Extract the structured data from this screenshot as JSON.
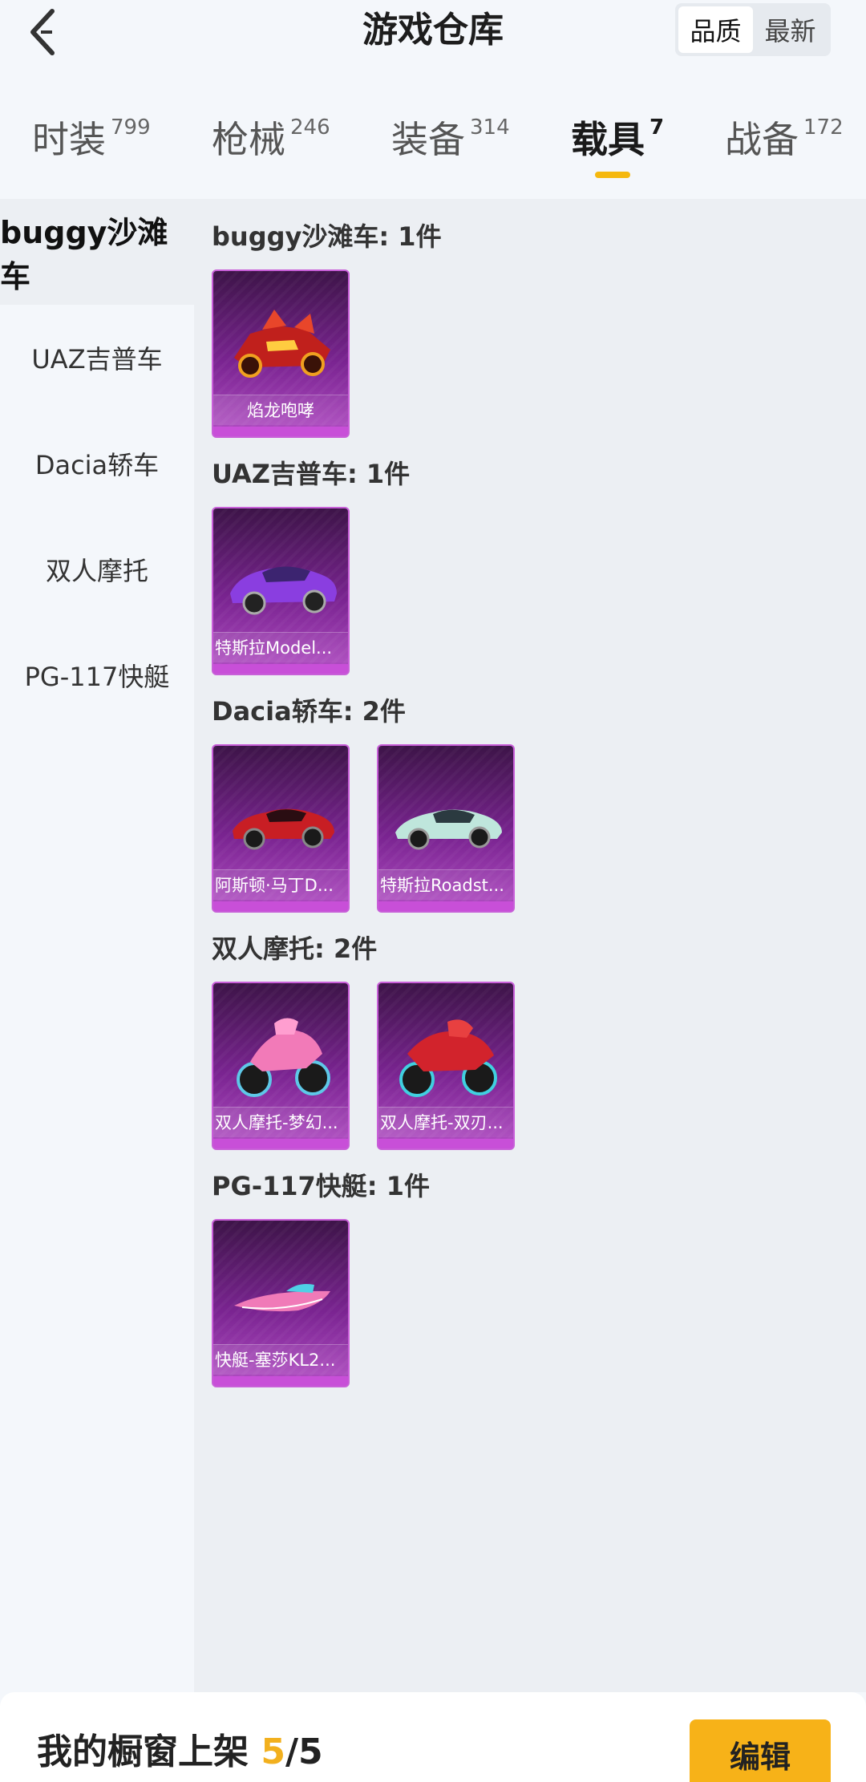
{
  "header": {
    "title": "游戏仓库",
    "sort_options": [
      "品质",
      "最新"
    ],
    "active_sort": "品质"
  },
  "tabs": [
    {
      "label": "时装",
      "count": "799"
    },
    {
      "label": "枪械",
      "count": "246"
    },
    {
      "label": "装备",
      "count": "314"
    },
    {
      "label": "载具",
      "count": "7"
    },
    {
      "label": "战备",
      "count": "172"
    }
  ],
  "sidebar": {
    "items": [
      "buggy沙滩车",
      "UAZ吉普车",
      "Dacia轿车",
      "双人摩托",
      "PG-117快艇"
    ]
  },
  "groups": [
    {
      "title": "buggy沙滩车: 1件",
      "items": [
        "焰龙咆哮"
      ]
    },
    {
      "title": "UAZ吉普车: 1件",
      "items": [
        "特斯拉Model..."
      ]
    },
    {
      "title": "Dacia轿车: 2件",
      "items": [
        "阿斯顿·马丁D...",
        "特斯拉Roadst..."
      ]
    },
    {
      "title": "双人摩托: 2件",
      "items": [
        "双人摩托-梦幻...",
        "双人摩托-双刃..."
      ]
    },
    {
      "title": "PG-117快艇: 1件",
      "items": [
        "快艇-塞莎KL2..."
      ]
    }
  ],
  "bottom": {
    "shelf_label": "我的橱窗上架",
    "shelf_current": "5",
    "shelf_total": "/5",
    "edit_label": "编辑"
  },
  "colors": {
    "accent": "#f7b218",
    "card_purple": "#7a2491"
  }
}
